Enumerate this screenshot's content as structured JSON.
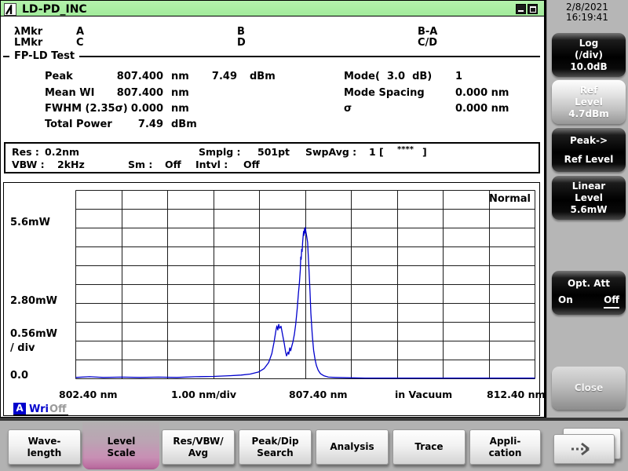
{
  "window": {
    "title": "LD-PD_INC"
  },
  "clock": {
    "date": "2/8/2021",
    "time": "16:19:41"
  },
  "markers": {
    "row1": {
      "label": "λMkr",
      "a": "A",
      "b": "B",
      "ba": "B-A"
    },
    "row2": {
      "label": "LMkr",
      "c": "C",
      "d": "D",
      "cd": "C/D"
    }
  },
  "analysis": {
    "group": "FP-LD Test",
    "left_rows": [
      {
        "label": "Peak",
        "v1": "807.400",
        "u1": "nm",
        "v2": "7.49",
        "u2": "dBm"
      },
      {
        "label": "Mean WI",
        "v1": "807.400",
        "u1": "nm",
        "v2": "",
        "u2": ""
      },
      {
        "label": "FWHM (2.35σ)",
        "v1": "0.000",
        "u1": "nm",
        "v2": "",
        "u2": ""
      },
      {
        "label": "Total Power",
        "v1": "7.49",
        "u1": "dBm",
        "v2": "",
        "u2": ""
      }
    ],
    "right_rows": [
      {
        "label": "Mode(  3.0  dB)",
        "value": "1"
      },
      {
        "label": "Mode Spacing",
        "value": "0.000 nm"
      },
      {
        "label": "σ",
        "value": "0.000 nm"
      }
    ]
  },
  "sweep": {
    "res_label": "Res :",
    "res": "0.2nm",
    "smplg_label": "Smplg :",
    "smplg": "501pt",
    "swpavg_label": "SwpAvg :",
    "swpavg_open": "1 [",
    "swpavg_stars": "****",
    "swpavg_close": "]",
    "vbw_label": "VBW :",
    "vbw": "2kHz",
    "sm_label": "Sm :",
    "sm": "Off",
    "intvl_label": "Intvl :",
    "intvl": "Off"
  },
  "trace_status": {
    "trace": "A",
    "mode": "Wri",
    "state": "Off"
  },
  "chart_data": {
    "type": "line",
    "mode_label": "Normal",
    "x_labels": [
      "802.40 nm",
      "1.00 nm/div",
      "807.40 nm",
      "in Vacuum",
      "812.40 nm"
    ],
    "y_labels": [
      "5.6mW",
      "2.80mW",
      "0.56mW",
      "/ div",
      "0.0"
    ],
    "xlim": [
      802.4,
      812.4
    ],
    "ylim": [
      0,
      5.6
    ],
    "x_unit": "nm",
    "y_unit": "mW",
    "divisions_x": 10,
    "divisions_y": 10,
    "grid": true,
    "series": [
      {
        "name": "A",
        "color": "#0000cc",
        "points": [
          [
            802.4,
            0.04
          ],
          [
            802.7,
            0.06
          ],
          [
            803.0,
            0.04
          ],
          [
            803.4,
            0.05
          ],
          [
            803.8,
            0.04
          ],
          [
            804.2,
            0.05
          ],
          [
            804.6,
            0.04
          ],
          [
            805.0,
            0.06
          ],
          [
            805.4,
            0.07
          ],
          [
            805.75,
            0.09
          ],
          [
            806.0,
            0.11
          ],
          [
            806.2,
            0.14
          ],
          [
            806.38,
            0.2
          ],
          [
            806.5,
            0.3
          ],
          [
            806.6,
            0.48
          ],
          [
            806.67,
            0.75
          ],
          [
            806.72,
            1.1
          ],
          [
            806.76,
            1.45
          ],
          [
            806.78,
            1.57
          ],
          [
            806.8,
            1.45
          ],
          [
            806.82,
            1.62
          ],
          [
            806.84,
            1.5
          ],
          [
            806.87,
            1.56
          ],
          [
            806.9,
            1.33
          ],
          [
            806.94,
            1.05
          ],
          [
            806.97,
            0.8
          ],
          [
            806.99,
            0.68
          ],
          [
            807.02,
            0.79
          ],
          [
            807.04,
            0.73
          ],
          [
            807.06,
            0.92
          ],
          [
            807.08,
            0.83
          ],
          [
            807.1,
            0.95
          ],
          [
            807.13,
            1.1
          ],
          [
            807.16,
            1.32
          ],
          [
            807.19,
            1.62
          ],
          [
            807.22,
            2.05
          ],
          [
            807.25,
            2.55
          ],
          [
            807.27,
            2.85
          ],
          [
            807.29,
            3.25
          ],
          [
            807.3,
            3.62
          ],
          [
            807.31,
            3.55
          ],
          [
            807.32,
            3.85
          ],
          [
            807.33,
            3.78
          ],
          [
            807.34,
            4.05
          ],
          [
            807.35,
            4.22
          ],
          [
            807.36,
            4.38
          ],
          [
            807.37,
            4.26
          ],
          [
            807.38,
            4.45
          ],
          [
            807.39,
            4.33
          ],
          [
            807.4,
            4.5
          ],
          [
            807.41,
            4.38
          ],
          [
            807.43,
            4.22
          ],
          [
            807.45,
            4.05
          ],
          [
            807.46,
            3.75
          ],
          [
            807.48,
            3.2
          ],
          [
            807.5,
            2.6
          ],
          [
            807.52,
            1.95
          ],
          [
            807.55,
            1.3
          ],
          [
            807.58,
            0.85
          ],
          [
            807.61,
            0.58
          ],
          [
            807.64,
            0.4
          ],
          [
            807.68,
            0.25
          ],
          [
            807.73,
            0.15
          ],
          [
            807.8,
            0.09
          ],
          [
            807.9,
            0.05
          ],
          [
            808.05,
            0.04
          ],
          [
            808.3,
            0.03
          ],
          [
            808.7,
            0.02
          ],
          [
            809.5,
            0.02
          ],
          [
            810.5,
            0.02
          ],
          [
            811.5,
            0.02
          ],
          [
            812.4,
            0.02
          ]
        ]
      }
    ]
  },
  "sidebar": {
    "buttons": [
      {
        "style": "black",
        "lines": [
          "Log",
          "(/div)",
          "10.0dB"
        ]
      },
      {
        "style": "silver",
        "lines": [
          "Ref",
          "Level",
          "4.7dBm"
        ]
      },
      {
        "style": "black",
        "lines": [
          "Peak->",
          "Ref Level"
        ]
      },
      {
        "style": "black",
        "lines": [
          "Linear",
          "Level",
          "5.6mW"
        ]
      },
      {
        "style": "black",
        "label": "Opt. Att",
        "on": "On",
        "off": "Off",
        "selected": "Off"
      },
      {
        "style": "gray",
        "lines": [
          "Close"
        ]
      }
    ]
  },
  "bottom_menu": {
    "items": [
      {
        "line1": "Wave-",
        "line2": "length",
        "selected": false
      },
      {
        "line1": "Level",
        "line2": "Scale",
        "selected": true
      },
      {
        "line1": "Res/VBW/",
        "line2": "Avg",
        "selected": false
      },
      {
        "line1": "Peak/Dip",
        "line2": "Search",
        "selected": false
      },
      {
        "line1": "Analysis",
        "line2": "",
        "selected": false
      },
      {
        "line1": "Trace",
        "line2": "",
        "selected": false
      },
      {
        "line1": "Appli-",
        "line2": "cation",
        "selected": false
      }
    ]
  },
  "colors": {
    "titlebar_green": "#aaf0a2",
    "trace_blue": "#0000cc",
    "selected_tab_pink": "#c479a6",
    "panel_gray": "#b6b6b6"
  }
}
